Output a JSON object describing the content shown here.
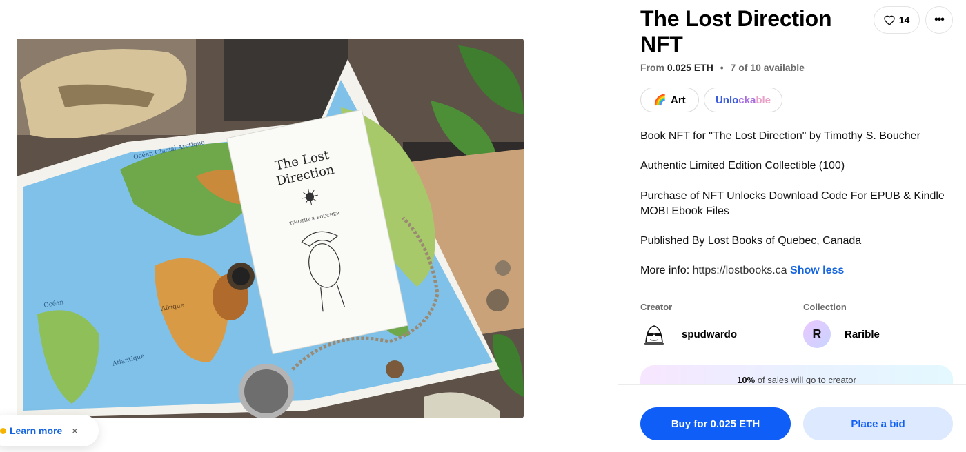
{
  "item": {
    "title": "The Lost Direction NFT",
    "like_count": "14",
    "more_label": "•••",
    "price_prefix": "From",
    "price": "0.025 ETH",
    "price_separator": "•",
    "availability": "7 of 10 available"
  },
  "tags": {
    "art_icon": "🌈",
    "art_label": "Art",
    "unlockable": [
      "Unlo",
      "cka",
      "ble"
    ]
  },
  "description": {
    "line1": "Book NFT for \"The Lost Direction\" by Timothy S. Boucher",
    "line2": "Authentic Limited Edition Collectible (100)",
    "line3": "Purchase of NFT Unlocks Download Code For EPUB & Kindle MOBI Ebook Files",
    "line4": "Published By Lost Books of Quebec, Canada",
    "more_info_label": "More info:",
    "more_info_url": "https://lostbooks.ca",
    "show_less": "Show less"
  },
  "creator": {
    "label": "Creator",
    "name": "spudwardo"
  },
  "collection": {
    "label": "Collection",
    "name": "Rarible",
    "logo_letter": "R"
  },
  "royalty": {
    "percent": "10%",
    "text": "of sales will go to creator"
  },
  "actions": {
    "buy_label": "Buy for 0.025 ETH",
    "bid_label": "Place a bid"
  },
  "learn_more": {
    "label": "Learn more",
    "close": "×"
  },
  "artwork": {
    "book_title_line1": "The Lost",
    "book_title_line2": "Direction",
    "book_author": "TIMOTHY S. BOUCHER",
    "map_labels": [
      "Océan Glacial Arctique",
      "Atlantique",
      "Afrique",
      "Océan"
    ]
  },
  "colors": {
    "accent": "#0f5ef7",
    "accent_soft": "#dde9fe",
    "link": "#1565e0"
  },
  "icons": [
    "heart-icon",
    "more-icon",
    "rainbow-icon",
    "close-icon",
    "lightbulb-icon"
  ]
}
